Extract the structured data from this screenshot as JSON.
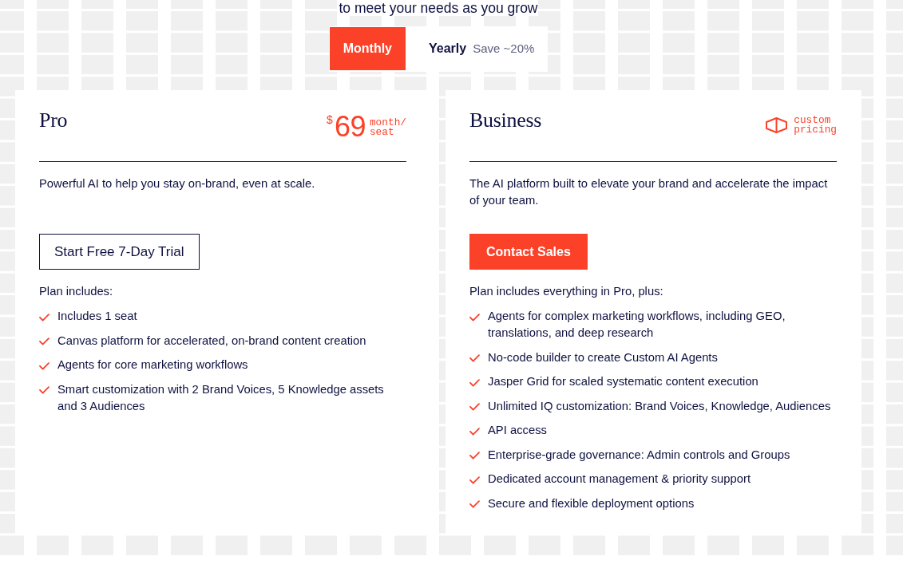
{
  "header": {
    "subtitle": "to meet your needs as you grow"
  },
  "billing_toggle": {
    "options": [
      {
        "label": "Monthly",
        "selected": true
      },
      {
        "label": "Yearly",
        "note": "Save ~20%",
        "selected": false
      }
    ]
  },
  "plans": [
    {
      "name": "Pro",
      "price": {
        "kind": "amount",
        "currency": "$",
        "amount": "69",
        "unit": "month/ seat"
      },
      "description": "Powerful AI to help you stay on-brand, even at scale.",
      "cta": {
        "label": "Start Free 7-Day Trial",
        "kind": "outline"
      },
      "features_heading": "Plan includes:",
      "features": [
        "Includes 1 seat",
        "Canvas platform for accelerated, on-brand content creation",
        "Agents for core marketing workflows",
        "Smart customization with 2 Brand Voices, 5 Knowledge assets and 3 Audiences"
      ]
    },
    {
      "name": "Business",
      "price": {
        "kind": "custom",
        "label": "custom pricing"
      },
      "description": "The AI platform built to elevate your brand and accelerate the impact of your team.",
      "cta": {
        "label": "Contact Sales",
        "kind": "filled"
      },
      "features_heading": "Plan includes everything in Pro, plus:",
      "features": [
        "Agents for complex marketing workflows, including GEO, translations, and deep research",
        "No-code builder to create Custom AI Agents",
        "Jasper Grid for scaled systematic content execution",
        "Unlimited IQ customization: Brand Voices, Knowledge, Audiences",
        "API access",
        "Enterprise-grade governance: Admin controls and Groups",
        "Dedicated account management & priority support",
        "Secure and flexible deployment options"
      ]
    }
  ]
}
